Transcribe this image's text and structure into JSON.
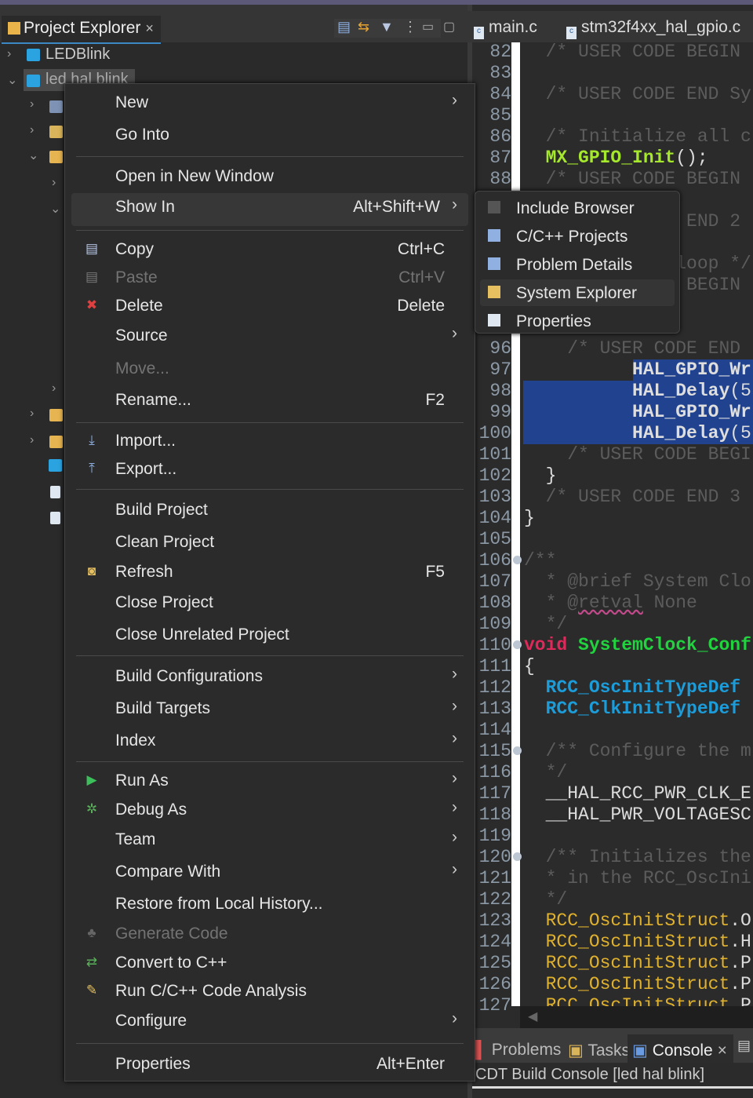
{
  "project_explorer": {
    "tab_label": "Project Explorer",
    "close": "×",
    "tree": [
      {
        "label": "LEDBlink",
        "expanded": false
      },
      {
        "label": "led hal blink",
        "expanded": true,
        "selected": true
      }
    ]
  },
  "editor": {
    "tabs": [
      "main.c",
      "stm32f4xx_hal_gpio.c"
    ],
    "lines": [
      {
        "n": "82",
        "t": [
          [
            "  /* USER CODE BEGIN ",
            "c-com"
          ]
        ]
      },
      {
        "n": "83",
        "t": []
      },
      {
        "n": "84",
        "t": [
          [
            "  /* USER CODE END Sy",
            "c-com"
          ]
        ]
      },
      {
        "n": "85",
        "t": []
      },
      {
        "n": "86",
        "t": [
          [
            "  /* Initialize all c",
            "c-com"
          ]
        ]
      },
      {
        "n": "87",
        "t": [
          [
            "  ",
            ""
          ],
          [
            "MX_GPIO_Init",
            "c-fn"
          ],
          [
            "();",
            "c-p"
          ]
        ]
      },
      {
        "n": "88",
        "t": [
          [
            "  /* USER CODE BEGIN ",
            "c-com"
          ]
        ]
      },
      {
        "n": "89",
        "t": []
      },
      {
        "n": "90",
        "t": [
          [
            "  /* USER CODE END 2",
            "c-com"
          ]
        ]
      },
      {
        "n": "91",
        "t": []
      },
      {
        "n": "92",
        "t": [
          [
            "  /* Infinite loop */",
            "c-com"
          ]
        ]
      },
      {
        "n": "93",
        "t": [
          [
            "  /* USER CODE BEGIN",
            "c-com"
          ]
        ]
      },
      {
        "n": "94",
        "t": []
      },
      {
        "n": "95",
        "t": []
      },
      {
        "n": "96",
        "t": [
          [
            "    /* USER CODE END ",
            "c-com"
          ]
        ]
      },
      {
        "n": "97",
        "t": [
          [
            "          HAL_GPIO_Wr",
            "c-bold"
          ]
        ],
        "sel": "partial"
      },
      {
        "n": "98",
        "t": [
          [
            "          HAL_Delay",
            "c-bold"
          ],
          [
            "(5",
            "c-p"
          ]
        ],
        "sel": "full"
      },
      {
        "n": "99",
        "t": [
          [
            "          HAL_GPIO_Wr",
            "c-bold"
          ]
        ],
        "sel": "full"
      },
      {
        "n": "100",
        "t": [
          [
            "          HAL_Delay",
            "c-bold"
          ],
          [
            "(5",
            "c-p"
          ]
        ],
        "sel": "full"
      },
      {
        "n": "101",
        "t": [
          [
            "    /* USER CODE BEGI",
            "c-com"
          ]
        ]
      },
      {
        "n": "102",
        "t": [
          [
            "  }",
            "c-p"
          ]
        ]
      },
      {
        "n": "103",
        "t": [
          [
            "  /* USER CODE END 3",
            "c-com"
          ]
        ]
      },
      {
        "n": "104",
        "t": [
          [
            "}",
            "c-p"
          ]
        ]
      },
      {
        "n": "105",
        "t": []
      },
      {
        "n": "106",
        "t": [
          [
            "/**",
            "c-doc"
          ]
        ],
        "fold": true
      },
      {
        "n": "107",
        "t": [
          [
            "  * @brief System Clo",
            "c-doc"
          ]
        ]
      },
      {
        "n": "108",
        "t": [
          [
            "  * @",
            "c-doc"
          ],
          [
            "retval",
            "c-doc squig"
          ],
          [
            " None",
            "c-doc"
          ]
        ]
      },
      {
        "n": "109",
        "t": [
          [
            "  */",
            "c-doc"
          ]
        ]
      },
      {
        "n": "110",
        "t": [
          [
            "void",
            "c-kw"
          ],
          [
            " ",
            ""
          ],
          [
            "SystemClock_Conf",
            "c-fn2"
          ]
        ],
        "fold": true
      },
      {
        "n": "111",
        "t": [
          [
            "{",
            "c-p"
          ]
        ]
      },
      {
        "n": "112",
        "t": [
          [
            "  ",
            ""
          ],
          [
            "RCC_OscInitTypeDef",
            "c-type"
          ]
        ]
      },
      {
        "n": "113",
        "t": [
          [
            "  ",
            ""
          ],
          [
            "RCC_ClkInitTypeDef",
            "c-type"
          ]
        ]
      },
      {
        "n": "114",
        "t": []
      },
      {
        "n": "115",
        "t": [
          [
            "  /** Configure the m",
            "c-doc"
          ]
        ],
        "fold": true
      },
      {
        "n": "116",
        "t": [
          [
            "  */",
            "c-doc"
          ]
        ]
      },
      {
        "n": "117",
        "t": [
          [
            "  __HAL_RCC_PWR_CLK_E",
            "c-mac"
          ]
        ]
      },
      {
        "n": "118",
        "t": [
          [
            "  __HAL_PWR_VOLTAGESC",
            "c-mac"
          ]
        ]
      },
      {
        "n": "119",
        "t": []
      },
      {
        "n": "120",
        "t": [
          [
            "  /** Initializes the",
            "c-doc"
          ]
        ],
        "fold": true
      },
      {
        "n": "121",
        "t": [
          [
            "  * in the RCC_OscIni",
            "c-doc"
          ]
        ]
      },
      {
        "n": "122",
        "t": [
          [
            "  */",
            "c-doc"
          ]
        ]
      },
      {
        "n": "123",
        "t": [
          [
            "  RCC_OscInitStruct",
            "c-var"
          ],
          [
            ".O",
            "c-p"
          ]
        ]
      },
      {
        "n": "124",
        "t": [
          [
            "  RCC_OscInitStruct",
            "c-var"
          ],
          [
            ".H",
            "c-p"
          ]
        ]
      },
      {
        "n": "125",
        "t": [
          [
            "  RCC_OscInitStruct",
            "c-var"
          ],
          [
            ".P",
            "c-p"
          ]
        ]
      },
      {
        "n": "126",
        "t": [
          [
            "  RCC_OscInitStruct",
            "c-var"
          ],
          [
            ".P",
            "c-p"
          ]
        ]
      },
      {
        "n": "127",
        "t": [
          [
            "  RCC_OscInitStruct",
            "c-var"
          ],
          [
            ".P",
            "c-p"
          ]
        ]
      }
    ]
  },
  "bottom_panel": {
    "tabs": [
      "Problems",
      "Tasks",
      "Console"
    ],
    "active": "Console",
    "close": "×",
    "console_title": "CDT Build Console [led hal blink]"
  },
  "context_menu": {
    "items": [
      {
        "label": "New",
        "submenu": true
      },
      {
        "label": "Go Into"
      },
      {
        "sep": true
      },
      {
        "label": "Open in New Window"
      },
      {
        "label": "Show In",
        "shortcut": "Alt+Shift+W",
        "submenu": true,
        "highlighted": true
      },
      {
        "sep": true
      },
      {
        "label": "Copy",
        "shortcut": "Ctrl+C",
        "icon": "copy-icon"
      },
      {
        "label": "Paste",
        "shortcut": "Ctrl+V",
        "icon": "paste-icon",
        "disabled": true
      },
      {
        "label": "Delete",
        "shortcut": "Delete",
        "icon": "delete-icon"
      },
      {
        "label": "Source",
        "submenu": true
      },
      {
        "label": "Move...",
        "disabled": true
      },
      {
        "label": "Rename...",
        "shortcut": "F2"
      },
      {
        "sep": true
      },
      {
        "label": "Import...",
        "icon": "import-icon"
      },
      {
        "label": "Export...",
        "icon": "export-icon"
      },
      {
        "sep": true
      },
      {
        "label": "Build Project"
      },
      {
        "label": "Clean Project"
      },
      {
        "label": "Refresh",
        "shortcut": "F5",
        "icon": "refresh-icon"
      },
      {
        "label": "Close Project"
      },
      {
        "label": "Close Unrelated Project"
      },
      {
        "sep": true
      },
      {
        "label": "Build Configurations",
        "submenu": true
      },
      {
        "label": "Build Targets",
        "submenu": true
      },
      {
        "label": "Index",
        "submenu": true
      },
      {
        "sep": true
      },
      {
        "label": "Run As",
        "submenu": true,
        "icon": "run-icon"
      },
      {
        "label": "Debug As",
        "submenu": true,
        "icon": "debug-icon"
      },
      {
        "label": "Team",
        "submenu": true
      },
      {
        "label": "Compare With",
        "submenu": true
      },
      {
        "label": "Restore from Local History..."
      },
      {
        "label": "Generate Code",
        "disabled": true,
        "icon": "generate-code-icon"
      },
      {
        "label": "Convert to C++",
        "icon": "convert-icon"
      },
      {
        "label": "Run C/C++ Code Analysis",
        "icon": "code-analysis-icon"
      },
      {
        "label": "Configure",
        "submenu": true
      },
      {
        "sep": true
      },
      {
        "label": "Properties",
        "shortcut": "Alt+Enter"
      }
    ]
  },
  "show_in_submenu": {
    "items": [
      {
        "label": "Include Browser",
        "icon": "include-browser-icon"
      },
      {
        "label": "C/C++ Projects",
        "icon": "cpp-projects-icon"
      },
      {
        "label": "Problem Details",
        "icon": "problem-details-icon"
      },
      {
        "label": "System Explorer",
        "icon": "system-explorer-icon",
        "highlighted": true
      },
      {
        "label": "Properties",
        "icon": "properties-icon"
      }
    ]
  },
  "colors": {
    "selection": "#21438f",
    "accent": "#3b88c4",
    "comment": "#5c5c5c",
    "function": "#a5e82c",
    "type": "#1c9cd9",
    "variable": "#e0b12c",
    "keyword": "#e0285a"
  }
}
